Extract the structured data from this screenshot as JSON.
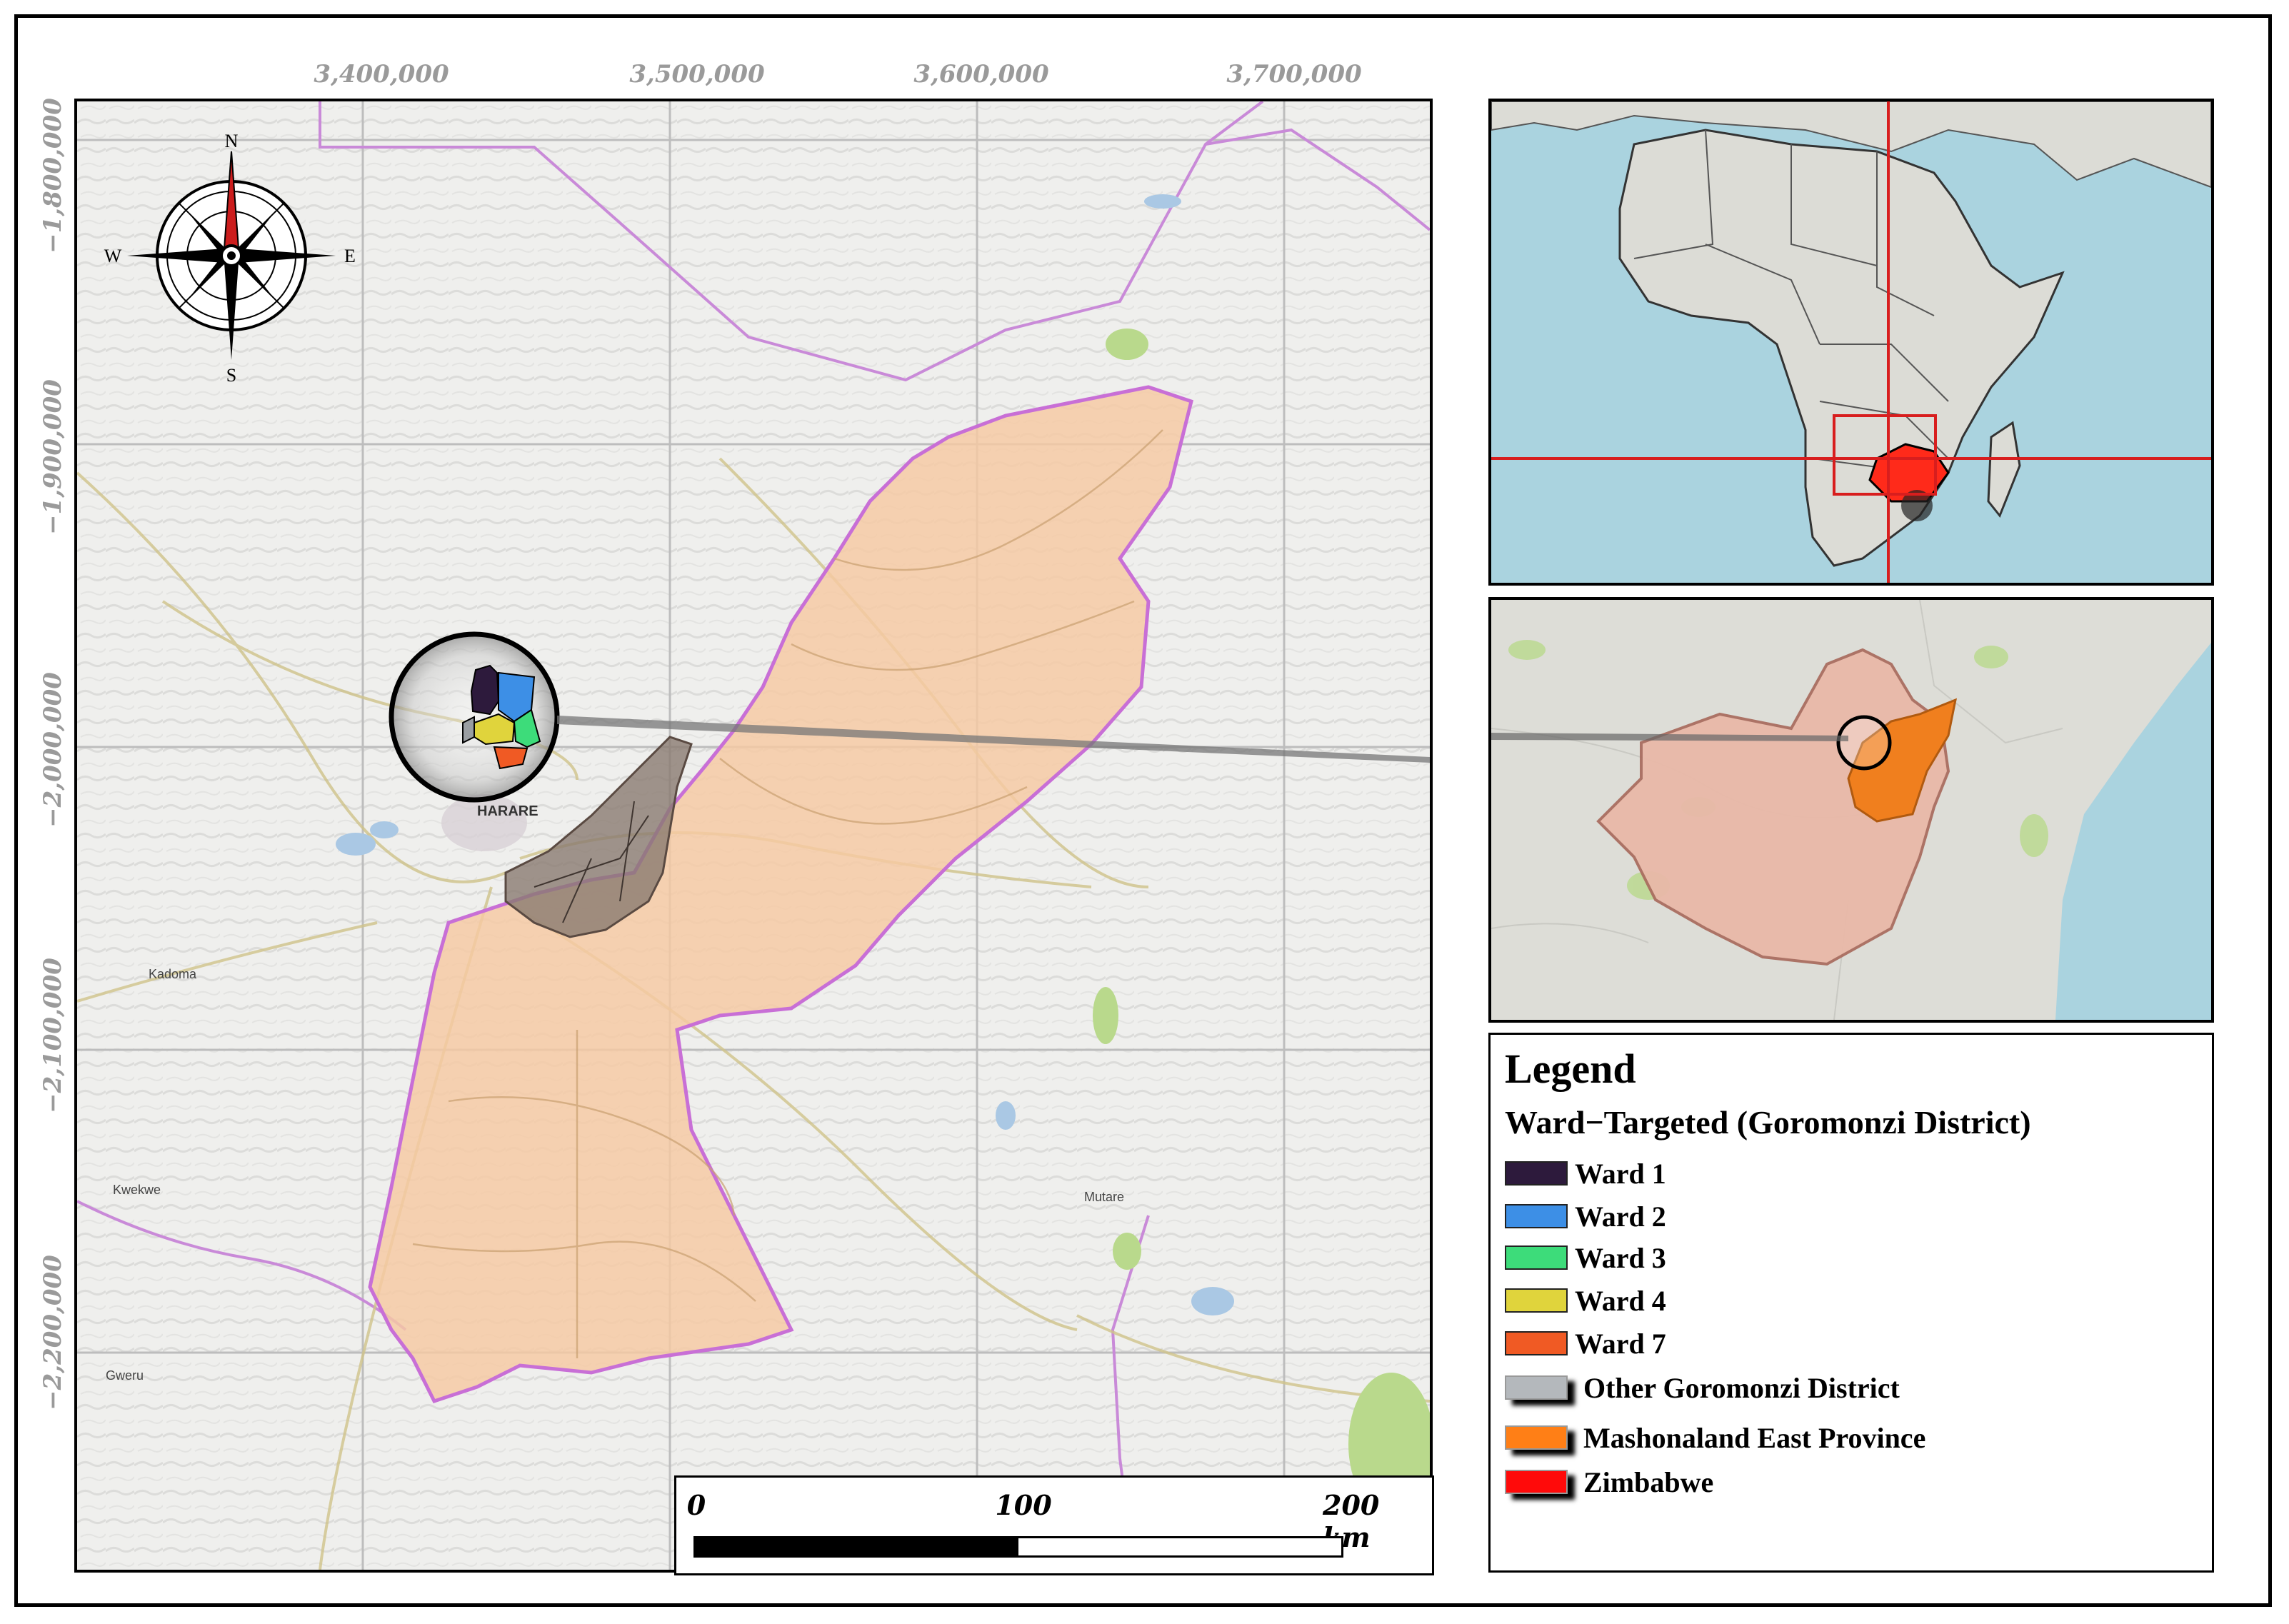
{
  "main_map": {
    "x_ticks": [
      "3,400,000",
      "3,500,000",
      "3,600,000",
      "3,700,000"
    ],
    "y_ticks": [
      "−1,800,000",
      "−1,900,000",
      "−2,000,000",
      "−2,100,000",
      "−2,200,000"
    ],
    "place_labels": {
      "harare": "HARARE",
      "kadoma": "Kadoma",
      "kwekwe": "Kwekwe",
      "mutare": "Mutare",
      "gweru": "Gweru"
    },
    "colors": {
      "province_fill": "#f6c9a2",
      "province_border": "#c86fd6",
      "district_fill": "#8a7a70",
      "ward1": "#2d1a3c",
      "ward2": "#3d8fe6",
      "ward3": "#3ddc7a",
      "ward4": "#e0d43c",
      "ward7": "#f05a24"
    }
  },
  "compass": {
    "n": "N",
    "s": "S",
    "e": "E",
    "w": "W"
  },
  "inset_africa": {
    "colors": {
      "ocean": "#aad3df",
      "land": "#dcdcd6",
      "zimbabwe": "#ff2a1a",
      "locator": "#d81e1e"
    }
  },
  "inset_zimbabwe": {
    "colors": {
      "zimbabwe_fill": "#e9b9a8",
      "province_fill": "#f07f1e",
      "ocean": "#aad3df"
    }
  },
  "legend": {
    "title": "Legend",
    "subtitle": "Ward−Targeted (Goromonzi District)",
    "items": [
      {
        "label": "Ward 1",
        "color": "#2d1a3c",
        "shadow": false
      },
      {
        "label": "Ward 2",
        "color": "#3d8fe6",
        "shadow": false
      },
      {
        "label": "Ward 3",
        "color": "#3ddc7a",
        "shadow": false
      },
      {
        "label": "Ward 4",
        "color": "#e0d43c",
        "shadow": false
      },
      {
        "label": "Ward 7",
        "color": "#f05a24",
        "shadow": false
      },
      {
        "label": "Other Goromonzi District",
        "color": "#b4b8bc",
        "shadow": true
      },
      {
        "label": "Mashonaland East Province",
        "color": "#ff7f16",
        "shadow": true
      },
      {
        "label": "Zimbabwe",
        "color": "#ff0a0a",
        "shadow": true
      }
    ]
  },
  "scale_bar": {
    "labels": [
      "0",
      "100",
      "200 km"
    ]
  }
}
